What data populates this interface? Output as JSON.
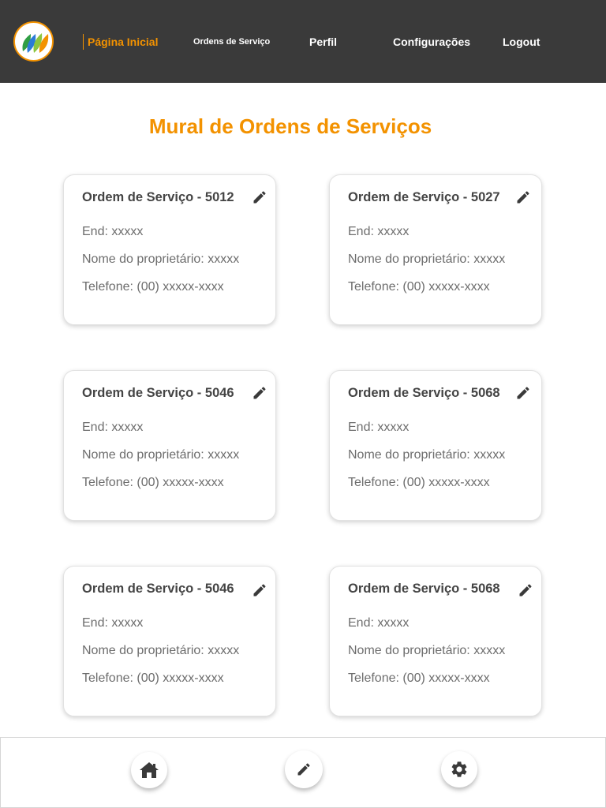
{
  "header": {
    "logo_icon": "leaves-logo-icon",
    "nav": [
      {
        "label": "Página Inicial",
        "active": true
      },
      {
        "label": "Ordens de Serviço"
      },
      {
        "label": "Perfil"
      },
      {
        "label": "Configurações"
      },
      {
        "label": "Logout"
      }
    ]
  },
  "main": {
    "title": "Mural de Ordens de Serviços",
    "cards": [
      {
        "title": "Ordem de Serviço - 5012",
        "end": "End: xxxxx",
        "owner": "Nome do proprietário: xxxxx",
        "phone": "Telefone: (00) xxxxx-xxxx"
      },
      {
        "title": "Ordem de Serviço - 5027",
        "end": "End: xxxxx",
        "owner": "Nome do proprietário: xxxxx",
        "phone": "Telefone: (00) xxxxx-xxxx"
      },
      {
        "title": "Ordem de Serviço - 5046",
        "end": "End: xxxxx",
        "owner": "Nome do proprietário: xxxxx",
        "phone": "Telefone: (00) xxxxx-xxxx"
      },
      {
        "title": "Ordem de Serviço - 5068",
        "end": "End: xxxxx",
        "owner": "Nome do proprietário: xxxxx",
        "phone": "Telefone: (00) xxxxx-xxxx"
      },
      {
        "title": "Ordem de Serviço - 5046",
        "end": "End: xxxxx",
        "owner": "Nome do proprietário: xxxxx",
        "phone": "Telefone: (00) xxxxx-xxxx"
      },
      {
        "title": "Ordem de Serviço - 5068",
        "end": "End: xxxxx",
        "owner": "Nome do proprietário: xxxxx",
        "phone": "Telefone: (00) xxxxx-xxxx"
      }
    ]
  },
  "bottom_bar": {
    "icons": [
      "home-icon",
      "pencil-icon",
      "gear-icon"
    ]
  },
  "colors": {
    "accent": "#f39200",
    "header_bg": "#3a3a3a",
    "text_dark": "#444444",
    "text_muted": "#6d6d6d"
  }
}
